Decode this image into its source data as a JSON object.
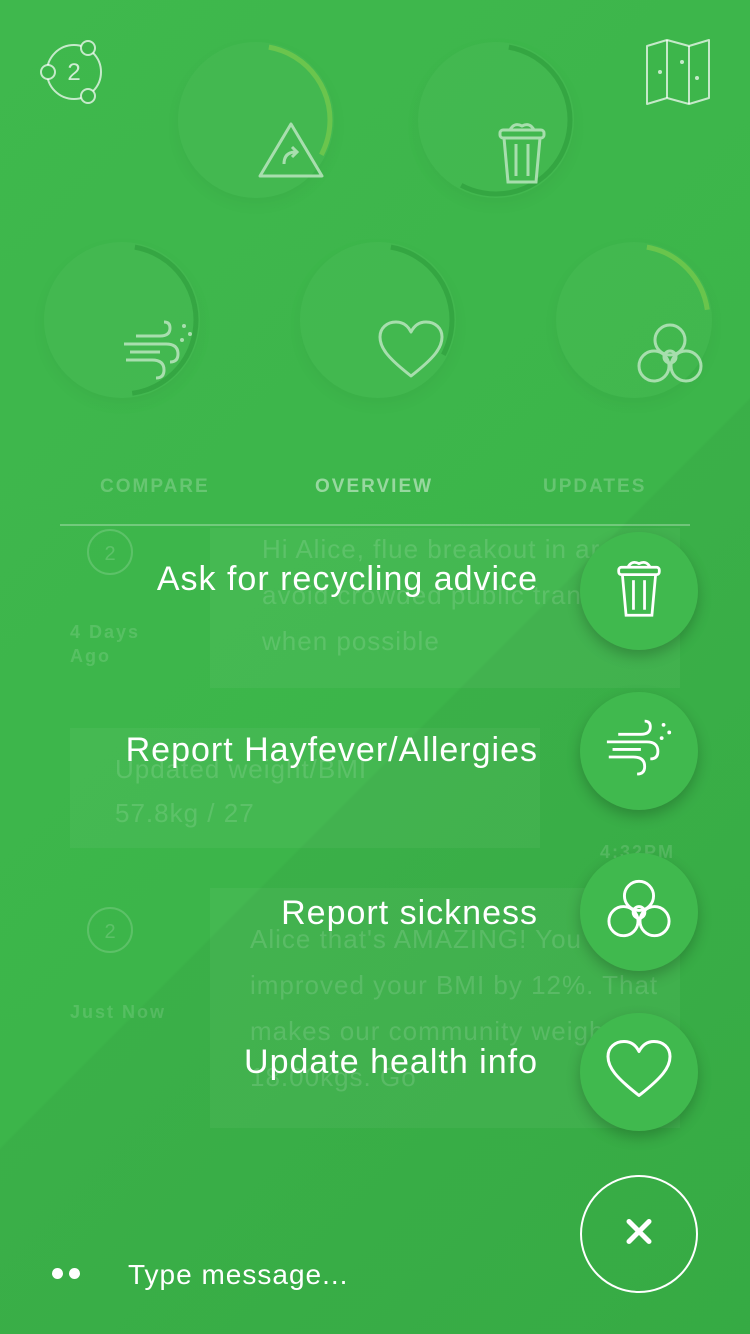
{
  "header": {
    "logo_badge": "2",
    "logo_icon": "community-logo-icon",
    "map_icon": "map-icon"
  },
  "stats": [
    {
      "icon": "hazard-report-icon",
      "progress": 0.3
    },
    {
      "icon": "trash-bin-icon",
      "progress": 0.55
    },
    {
      "icon": "wind-allergy-icon",
      "progress": 0.45
    },
    {
      "icon": "heart-icon",
      "progress": 0.3
    },
    {
      "icon": "biohazard-icon",
      "progress": 0.2
    }
  ],
  "tabs": [
    {
      "label": "COMPARE",
      "active": false
    },
    {
      "label": "OVERVIEW",
      "active": true
    },
    {
      "label": "UPDATES",
      "active": false
    }
  ],
  "feed": {
    "item1": {
      "badge": "2",
      "time": "4 Days Ago",
      "text": "Hi Alice, flue breakout in area, avoid crowded public transport when possible"
    },
    "item2": {
      "title": "Updated weight/BMI",
      "value": "57.8kg / 27",
      "time": "4:32PM"
    },
    "item3": {
      "badge": "2",
      "time": "Just Now",
      "text": "Alice that's AMAZING! You improved your BMI by 12%. That makes our community weightloss 18.00kgs. Go"
    }
  },
  "menu": [
    {
      "label": "Ask for recycling advice",
      "icon": "trash-bin-icon"
    },
    {
      "label": "Report Hayfever/Allergies",
      "icon": "wind-allergy-icon"
    },
    {
      "label": "Report sickness",
      "icon": "biohazard-icon"
    },
    {
      "label": "Update health info",
      "icon": "heart-icon"
    }
  ],
  "close_label": "×",
  "composer": {
    "placeholder": "Type message..."
  },
  "colors": {
    "background": "#3cb54a",
    "fab": "#40b94e",
    "accent_light": "#8fd14f",
    "accent_dark": "#2f9a3c",
    "text": "#ffffff"
  }
}
